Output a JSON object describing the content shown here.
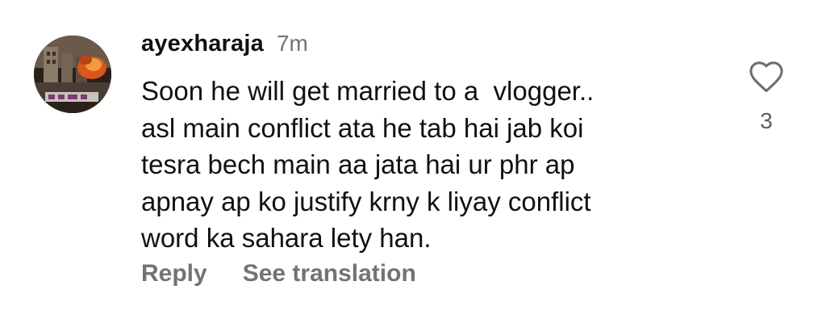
{
  "comment": {
    "avatar_icon": "profile-picture",
    "username": "ayexharaja",
    "timestamp": "7m",
    "text": "Soon he will get married to a  vlogger..\nasl main conflict ata he tab hai jab koi\ntesra bech main aa jata hai ur phr ap\napnay ap ko justify krny k liyay conflict\nword ka sahara lety han.",
    "reply_label": "Reply",
    "translation_label": "See translation",
    "like_icon": "heart-outline-icon",
    "like_count": "3"
  }
}
